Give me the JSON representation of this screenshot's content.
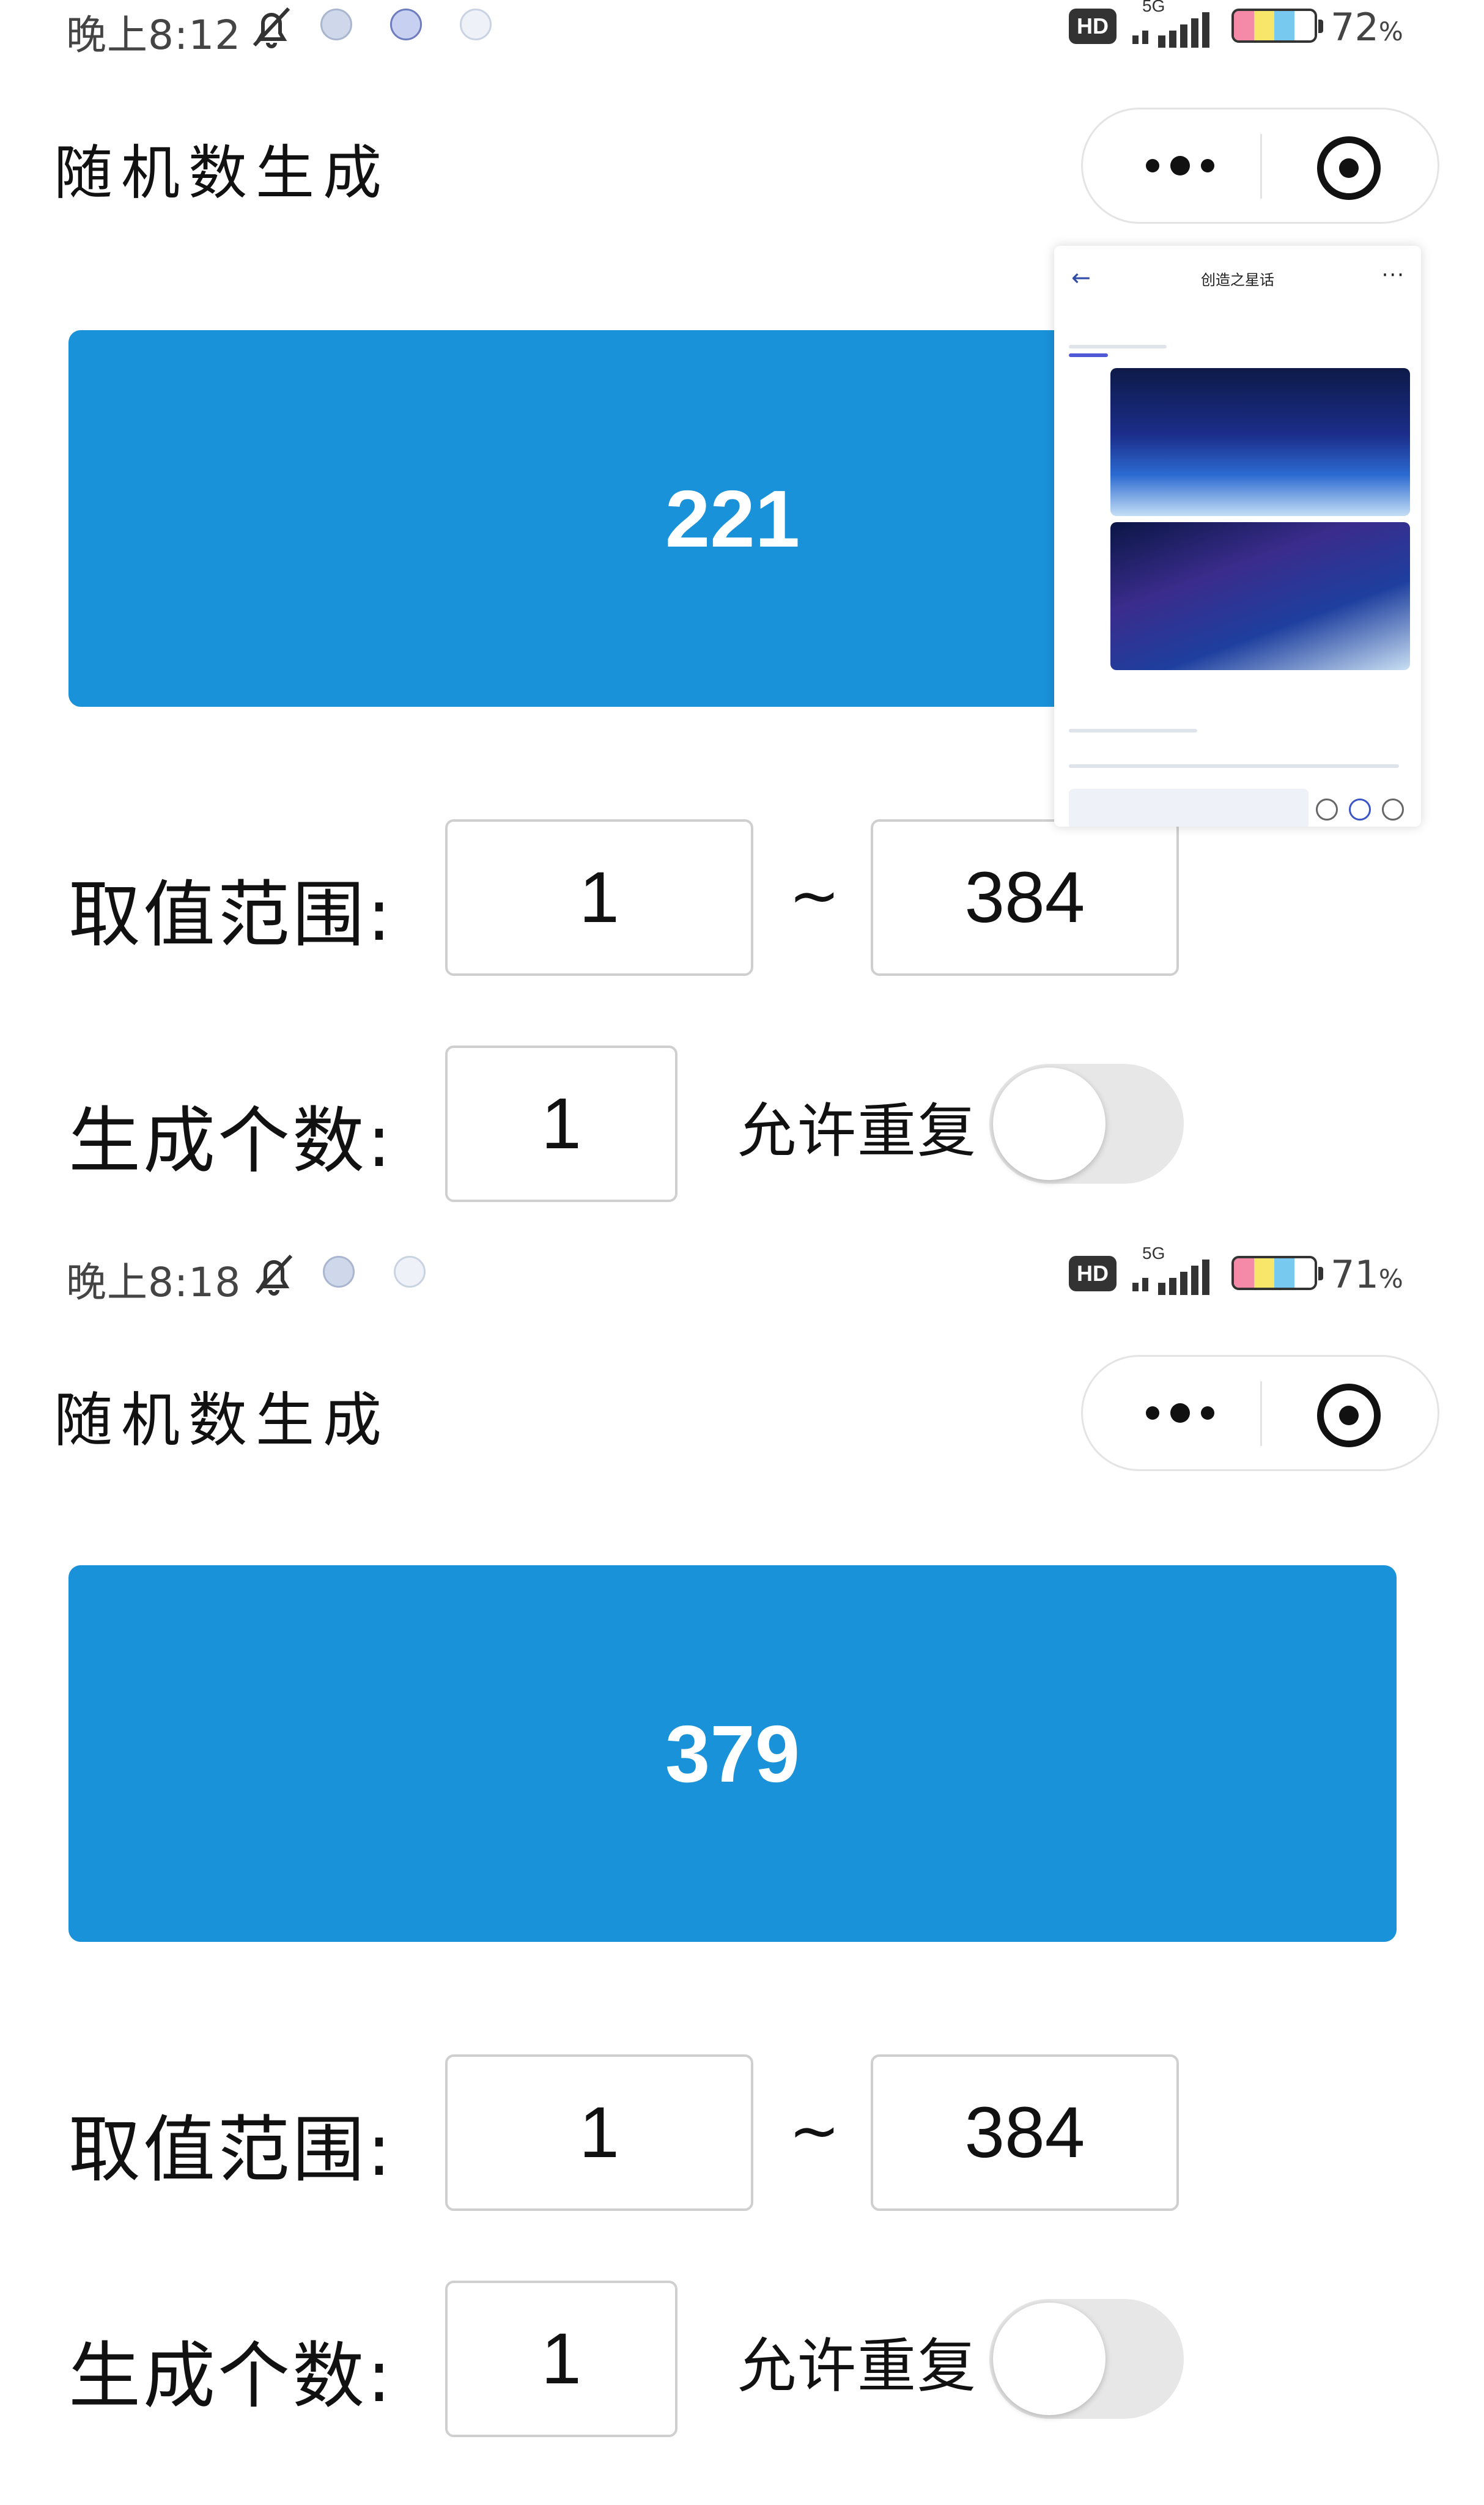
{
  "screens": [
    {
      "status": {
        "time": "晚上8:12",
        "network": "5G",
        "hd": "HD",
        "battery_percent": "72",
        "percent_sign": "%"
      },
      "nav": {
        "title": "随机数生成"
      },
      "result": "221",
      "range": {
        "label": "取值范围:",
        "min": "1",
        "separator": "~",
        "max": "384"
      },
      "count": {
        "label": "生成个数:",
        "value": "1"
      },
      "repeat": {
        "label": "允许重复",
        "enabled": false
      }
    },
    {
      "status": {
        "time": "晚上8:18",
        "network": "5G",
        "hd": "HD",
        "battery_percent": "71",
        "percent_sign": "%"
      },
      "nav": {
        "title": "随机数生成"
      },
      "result": "379",
      "range": {
        "label": "取值范围:",
        "min": "1",
        "separator": "~",
        "max": "384"
      },
      "count": {
        "label": "生成个数:",
        "value": "1"
      },
      "repeat": {
        "label": "允许重复",
        "enabled": false
      }
    }
  ],
  "floating_window": {
    "title": "创造之星话",
    "back_icon": "arrow-left-icon",
    "more_icon": "more-dots-icon"
  },
  "icons": {
    "status": [
      "silent-bell-icon",
      "app-notification-icon",
      "signal-icon",
      "battery-icon"
    ],
    "capsule": [
      "more-dots-icon",
      "target-icon"
    ]
  },
  "colors": {
    "accent": "#1a92d9",
    "switch_off": "#e7e7e7",
    "input_border": "#cfcfcf"
  }
}
